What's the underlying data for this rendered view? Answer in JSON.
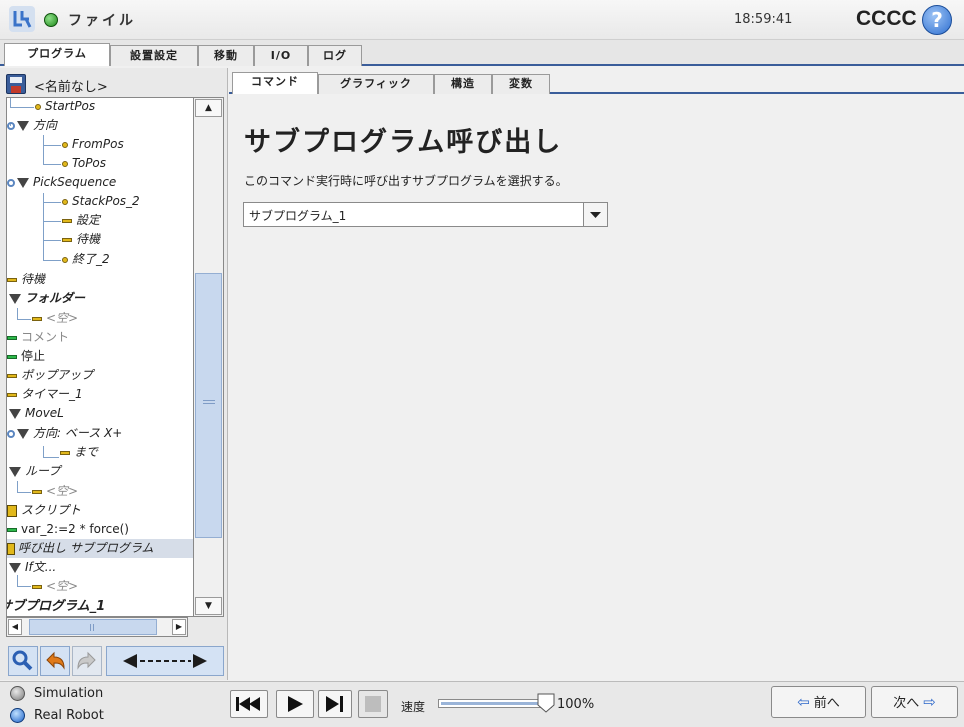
{
  "header": {
    "app_label": "ファイル",
    "time": "18:59:41",
    "robot_name": "CCCC",
    "help_icon": "?"
  },
  "main_tabs": [
    "プログラム",
    "設置設定",
    "移動",
    "I/O",
    "ログ"
  ],
  "program": {
    "name": "<名前なし>"
  },
  "tree": [
    {
      "label": "StartPos"
    },
    {
      "label": "方向"
    },
    {
      "label": "FromPos"
    },
    {
      "label": "ToPos"
    },
    {
      "label": "PickSequence"
    },
    {
      "label": "StackPos_2"
    },
    {
      "label": "設定"
    },
    {
      "label": "待機"
    },
    {
      "label": "終了_2"
    },
    {
      "label": "待機"
    },
    {
      "label": "フォルダー"
    },
    {
      "label": "<空>"
    },
    {
      "label": "コメント"
    },
    {
      "label": "停止"
    },
    {
      "label": "ポップアップ"
    },
    {
      "label": "タイマー_1"
    },
    {
      "label": "MoveL"
    },
    {
      "label": "方向: ベース X+"
    },
    {
      "label": "まで"
    },
    {
      "label": "ループ"
    },
    {
      "label": "<空>"
    },
    {
      "label": "スクリプト"
    },
    {
      "label": "var_2:=2 * force()"
    },
    {
      "label": "呼び出し サブプログラム"
    },
    {
      "label": "If文..."
    },
    {
      "label": "<空>"
    },
    {
      "label": "サブプログラム_1"
    }
  ],
  "sub_tabs": [
    "コマンド",
    "グラフィック",
    "構造",
    "変数"
  ],
  "command": {
    "title": "サブプログラム呼び出し",
    "description": "このコマンド実行時に呼び出すサブプログラムを選択する。",
    "selected_subprogram": "サブプログラム_1"
  },
  "footer": {
    "simulation": "Simulation",
    "real_robot": "Real Robot",
    "speed_label": "速度",
    "speed_value": "100%",
    "speed_fraction": 1.0,
    "prev_label": "前へ",
    "next_label": "次へ"
  },
  "colors": {
    "accent": "#3a5d9a",
    "selected": "#d6dde8",
    "logo": "#3a73c9",
    "help": "#3a7ad6"
  }
}
